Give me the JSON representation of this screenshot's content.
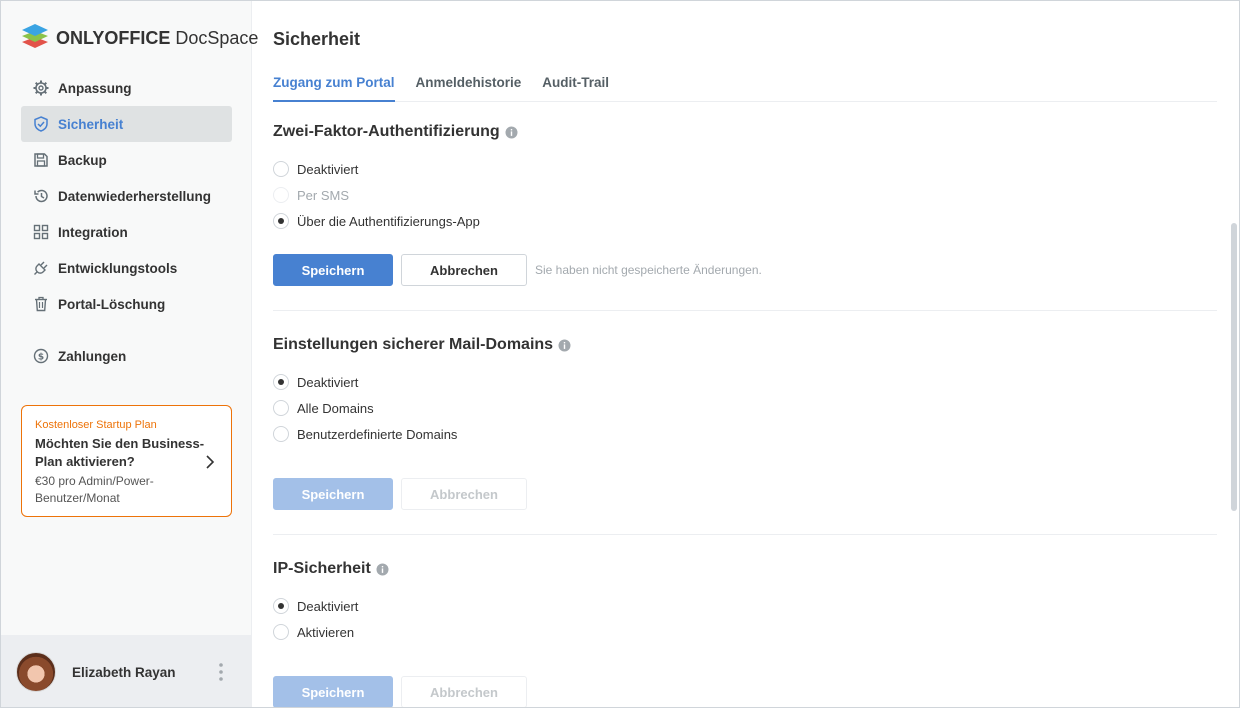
{
  "app": {
    "brand_bold": "ONLYOFFICE",
    "brand_light": " DocSpace"
  },
  "sidebar": {
    "items": [
      {
        "label": "Anpassung",
        "icon": "gear-icon"
      },
      {
        "label": "Sicherheit",
        "icon": "shield-icon",
        "active": true
      },
      {
        "label": "Backup",
        "icon": "floppy-icon"
      },
      {
        "label": "Datenwiederherstellung",
        "icon": "restore-icon"
      },
      {
        "label": "Integration",
        "icon": "grid-icon"
      },
      {
        "label": "Entwicklungstools",
        "icon": "plug-icon"
      },
      {
        "label": "Portal-Löschung",
        "icon": "trash-icon"
      },
      {
        "label": "Zahlungen",
        "icon": "coin-icon"
      }
    ],
    "promo": {
      "tag": "Kostenloser Startup Plan",
      "title": "Möchten Sie den Business-Plan aktivieren?",
      "price": "€30 pro Admin/Power-Benutzer/Monat"
    },
    "user": {
      "name": "Elizabeth Rayan"
    }
  },
  "main": {
    "title": "Sicherheit",
    "tabs": [
      {
        "label": "Zugang zum Portal",
        "active": true
      },
      {
        "label": "Anmeldehistorie"
      },
      {
        "label": "Audit-Trail"
      }
    ],
    "two_factor": {
      "title": "Zwei-Faktor-Authentifizierung",
      "options": [
        {
          "label": "Deaktiviert",
          "checked": false
        },
        {
          "label": "Per SMS",
          "checked": false,
          "disabled": true
        },
        {
          "label": "Über die Authentifizierungs-App",
          "checked": true
        }
      ],
      "save": "Speichern",
      "cancel": "Abbrechen",
      "unsaved_note": "Sie haben nicht gespeicherte Änderungen."
    },
    "mail_domains": {
      "title": "Einstellungen sicherer Mail-Domains",
      "options": [
        {
          "label": "Deaktiviert",
          "checked": true
        },
        {
          "label": "Alle Domains",
          "checked": false
        },
        {
          "label": "Benutzerdefinierte Domains",
          "checked": false
        }
      ],
      "save": "Speichern",
      "cancel": "Abbrechen"
    },
    "ip_security": {
      "title": "IP-Sicherheit",
      "options": [
        {
          "label": "Deaktiviert",
          "checked": true
        },
        {
          "label": "Aktivieren",
          "checked": false
        }
      ],
      "save": "Speichern",
      "cancel": "Abbrechen"
    }
  },
  "colors": {
    "accent": "#4781d1",
    "promo": "#ed7309"
  }
}
